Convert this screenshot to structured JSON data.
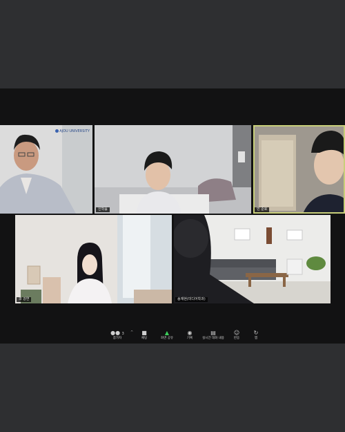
{
  "participants": [
    {
      "id": "p1",
      "name": "",
      "logo_text": "AJOU UNIVERSITY"
    },
    {
      "id": "p2",
      "name": "신학휼"
    },
    {
      "id": "p3",
      "name": "민 준호",
      "active": true
    },
    {
      "id": "p4",
      "name": "코 강연"
    },
    {
      "id": "p5",
      "name": "송재현(미디어학과)"
    }
  ],
  "toolbar": {
    "participants_count": "3",
    "items": [
      {
        "key": "participants",
        "label": "참가자",
        "icon": "participants-icon"
      },
      {
        "key": "chat",
        "label": "채팅",
        "icon": "chat-icon"
      },
      {
        "key": "share",
        "label": "화면 공유",
        "icon": "share-screen-icon",
        "color": "#3ccf5b"
      },
      {
        "key": "record",
        "label": "기록",
        "icon": "record-icon"
      },
      {
        "key": "captions",
        "label": "실시간 대화 내용",
        "icon": "captions-icon"
      },
      {
        "key": "reactions",
        "label": "반응",
        "icon": "reactions-icon"
      },
      {
        "key": "apps",
        "label": "앱",
        "icon": "apps-icon"
      }
    ]
  }
}
